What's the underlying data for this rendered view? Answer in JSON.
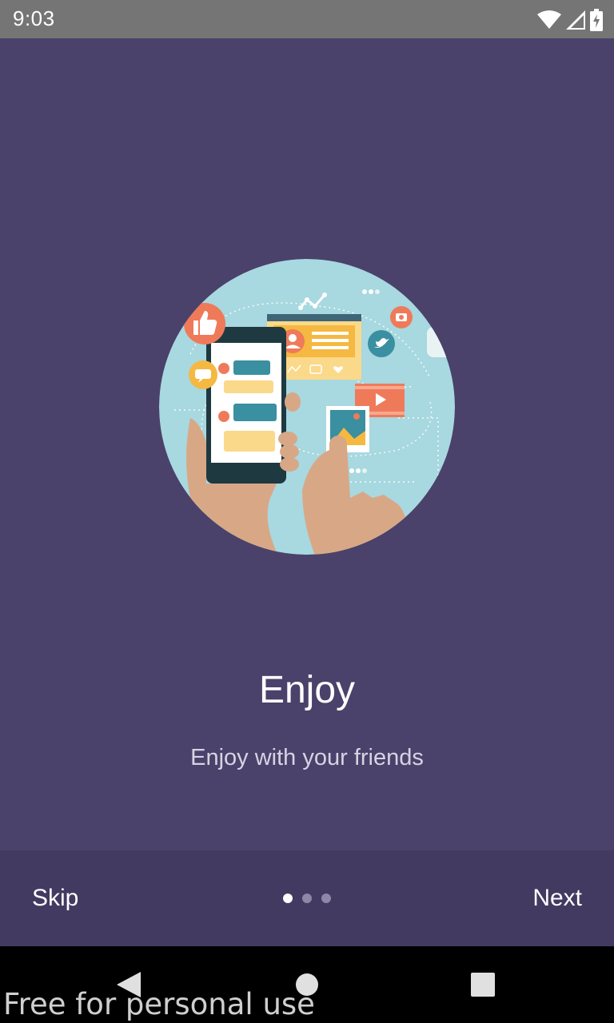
{
  "status_bar": {
    "time": "9:03",
    "icons": [
      "wifi-icon",
      "cell-signal-icon",
      "battery-charging-icon"
    ]
  },
  "onboarding": {
    "illustration": "social-media-phone-illustration",
    "title": "Enjoy",
    "subtitle": "Enjoy with your friends"
  },
  "bottom_bar": {
    "skip_label": "Skip",
    "next_label": "Next",
    "page_count": 3,
    "current_page": 1
  },
  "nav_bar": {
    "icons": [
      "back-icon",
      "home-icon",
      "recents-icon"
    ]
  },
  "watermark": "Free for personal use",
  "colors": {
    "background": "#4a426a",
    "bottom_bar": "#423a60",
    "status_bar": "#757575",
    "circle": "#a8d8e0",
    "accent_orange": "#ef7a5a"
  }
}
